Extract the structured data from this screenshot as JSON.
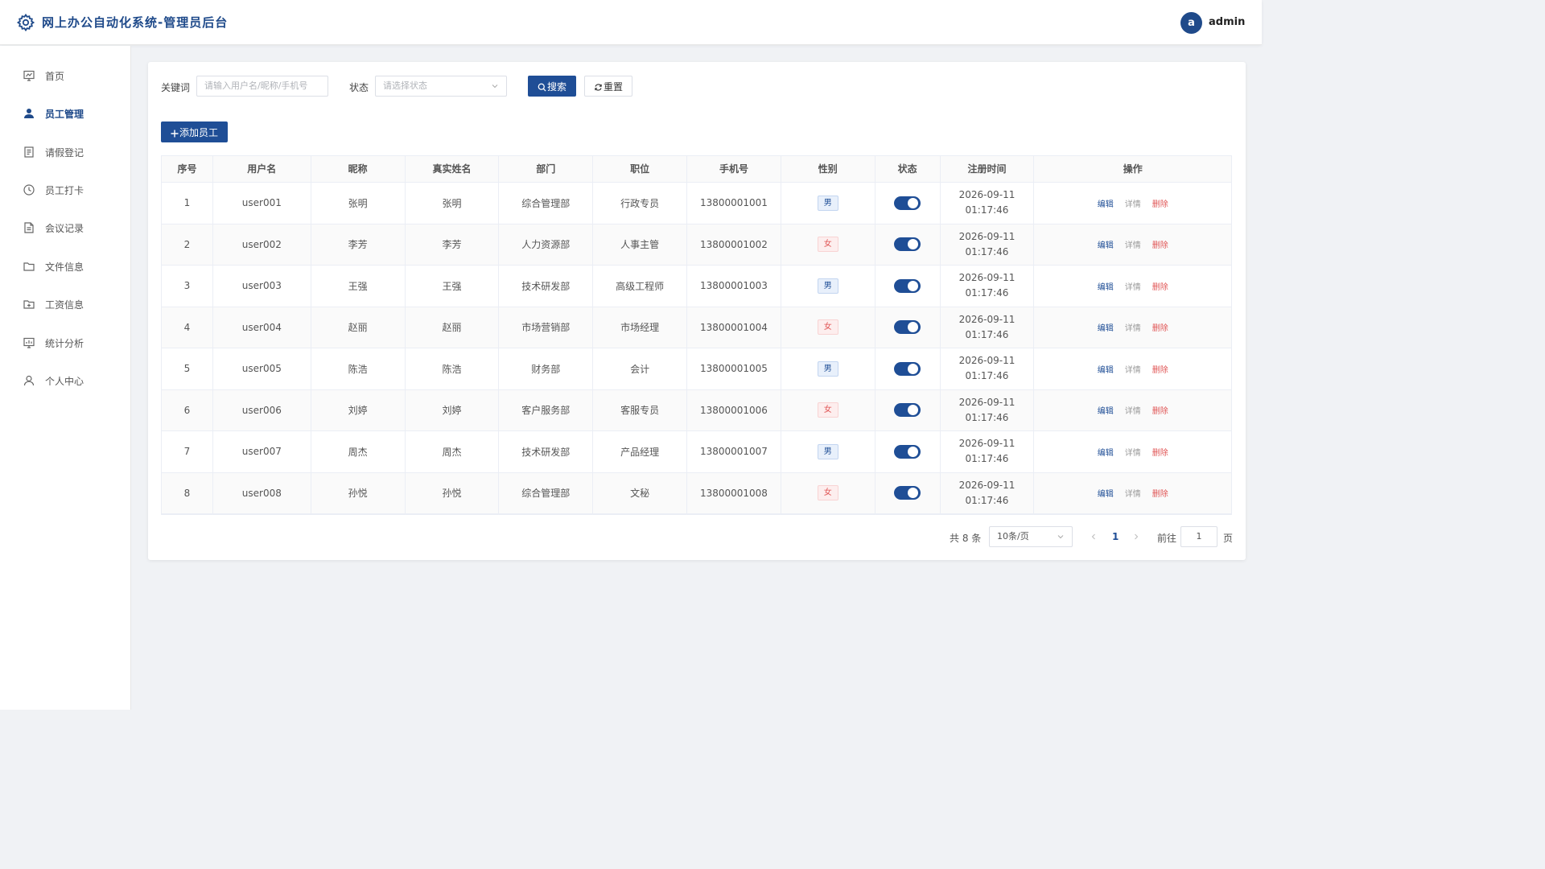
{
  "header": {
    "title": "网上办公自动化系统-管理员后台",
    "avatar_letter": "a",
    "username": "admin",
    "logo_icon": "gear-icon"
  },
  "sidebar": {
    "items": [
      {
        "label": "首页",
        "icon": "dashboard-icon",
        "active": false
      },
      {
        "label": "员工管理",
        "icon": "user-icon",
        "active": true
      },
      {
        "label": "请假登记",
        "icon": "document-icon",
        "active": false
      },
      {
        "label": "员工打卡",
        "icon": "clock-icon",
        "active": false
      },
      {
        "label": "会议记录",
        "icon": "file-icon",
        "active": false
      },
      {
        "label": "文件信息",
        "icon": "folder-icon",
        "active": false
      },
      {
        "label": "工资信息",
        "icon": "folder-add-icon",
        "active": false
      },
      {
        "label": "统计分析",
        "icon": "chart-icon",
        "active": false
      },
      {
        "label": "个人中心",
        "icon": "person-icon",
        "active": false
      }
    ]
  },
  "filters": {
    "keyword_label": "关键词",
    "keyword_placeholder": "请输入用户名/昵称/手机号",
    "status_label": "状态",
    "status_placeholder": "请选择状态",
    "search_label": "搜索",
    "reset_label": "重置",
    "add_label": "添加员工"
  },
  "table": {
    "columns": [
      "序号",
      "用户名",
      "昵称",
      "真实姓名",
      "部门",
      "职位",
      "手机号",
      "性别",
      "状态",
      "注册时间",
      "操作"
    ],
    "rows": [
      {
        "index": "1",
        "username": "user001",
        "nickname": "张明",
        "realname": "张明",
        "dept": "综合管理部",
        "position": "行政专员",
        "phone": "13800001001",
        "gender": "男",
        "status": true,
        "date": "2026-09-11",
        "time": "01:17:46"
      },
      {
        "index": "2",
        "username": "user002",
        "nickname": "李芳",
        "realname": "李芳",
        "dept": "人力资源部",
        "position": "人事主管",
        "phone": "13800001002",
        "gender": "女",
        "status": true,
        "date": "2026-09-11",
        "time": "01:17:46"
      },
      {
        "index": "3",
        "username": "user003",
        "nickname": "王强",
        "realname": "王强",
        "dept": "技术研发部",
        "position": "高级工程师",
        "phone": "13800001003",
        "gender": "男",
        "status": true,
        "date": "2026-09-11",
        "time": "01:17:46"
      },
      {
        "index": "4",
        "username": "user004",
        "nickname": "赵丽",
        "realname": "赵丽",
        "dept": "市场营销部",
        "position": "市场经理",
        "phone": "13800001004",
        "gender": "女",
        "status": true,
        "date": "2026-09-11",
        "time": "01:17:46"
      },
      {
        "index": "5",
        "username": "user005",
        "nickname": "陈浩",
        "realname": "陈浩",
        "dept": "财务部",
        "position": "会计",
        "phone": "13800001005",
        "gender": "男",
        "status": true,
        "date": "2026-09-11",
        "time": "01:17:46"
      },
      {
        "index": "6",
        "username": "user006",
        "nickname": "刘婷",
        "realname": "刘婷",
        "dept": "客户服务部",
        "position": "客服专员",
        "phone": "13800001006",
        "gender": "女",
        "status": true,
        "date": "2026-09-11",
        "time": "01:17:46"
      },
      {
        "index": "7",
        "username": "user007",
        "nickname": "周杰",
        "realname": "周杰",
        "dept": "技术研发部",
        "position": "产品经理",
        "phone": "13800001007",
        "gender": "男",
        "status": true,
        "date": "2026-09-11",
        "time": "01:17:46"
      },
      {
        "index": "8",
        "username": "user008",
        "nickname": "孙悦",
        "realname": "孙悦",
        "dept": "综合管理部",
        "position": "文秘",
        "phone": "13800001008",
        "gender": "女",
        "status": true,
        "date": "2026-09-11",
        "time": "01:17:46"
      }
    ],
    "actions": {
      "edit": "编辑",
      "detail": "详情",
      "delete": "删除"
    }
  },
  "pagination": {
    "total": "共 8 条",
    "page_size": "10条/页",
    "current_page": "1",
    "goto_label": "前往",
    "goto_value": "1",
    "page_suffix": "页"
  },
  "colors": {
    "primary": "#1f4e96",
    "danger": "#e05555"
  }
}
